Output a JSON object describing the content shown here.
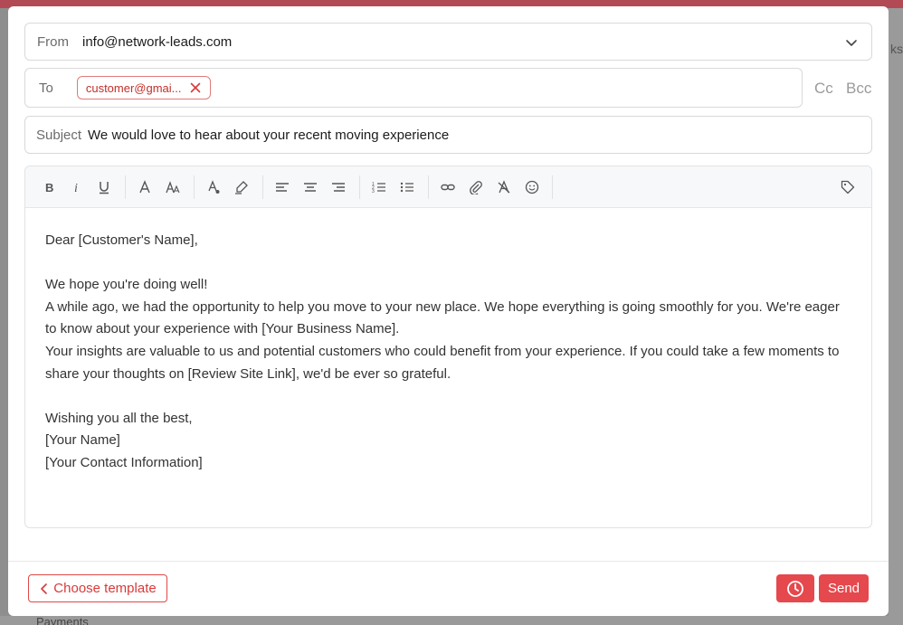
{
  "background": {
    "right_fragment": "ks",
    "bottom_fragment": "Payments"
  },
  "from": {
    "label": "From",
    "value": "info@network-leads.com"
  },
  "to": {
    "label": "To",
    "recipients": [
      "customer@gmai..."
    ]
  },
  "cc_label": "Cc",
  "bcc_label": "Bcc",
  "subject": {
    "label": "Subject",
    "value": "We would love to hear about your recent moving experience"
  },
  "toolbar": {
    "icons": [
      "bold-icon",
      "italic-icon",
      "underline-icon",
      "font-icon",
      "font-size-icon",
      "text-color-icon",
      "highlight-icon",
      "align-left-icon",
      "align-center-icon",
      "align-right-icon",
      "ordered-list-icon",
      "bullet-list-icon",
      "link-icon",
      "attachment-icon",
      "clear-format-icon",
      "emoji-icon",
      "tag-icon"
    ]
  },
  "body": {
    "lines": [
      "Dear [Customer's Name],",
      "",
      "We hope you're doing well!",
      "A while ago, we had the opportunity to help you move to your new place. We hope everything is going smoothly for you. We're eager to know about your experience with [Your Business Name].",
      "Your insights are valuable to us and potential customers who could benefit from your experience. If you could take a few moments to share your thoughts on [Review Site Link], we'd be ever so grateful.",
      "",
      "Wishing you all the best,",
      "[Your Name]",
      "[Your Contact Information]"
    ]
  },
  "footer": {
    "choose_template_label": "Choose template",
    "send_label": "Send"
  },
  "colors": {
    "accent": "#e5484d",
    "chip_text": "#c0302b"
  }
}
